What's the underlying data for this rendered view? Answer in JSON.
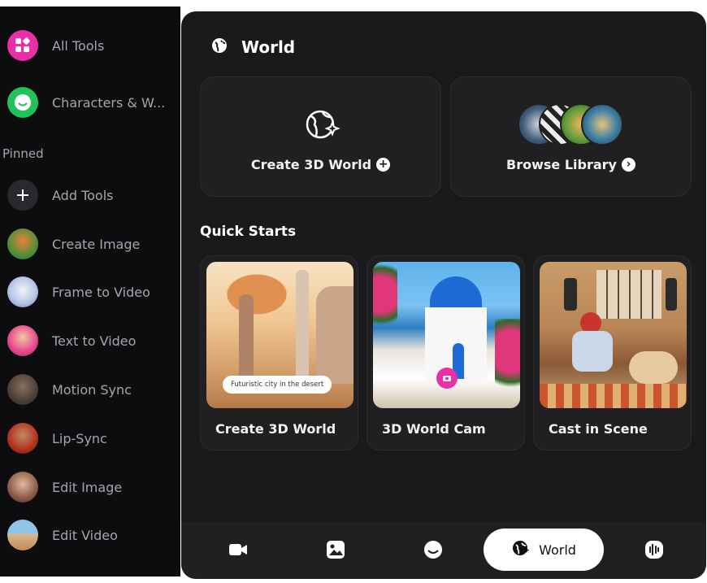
{
  "sidebar": {
    "items": [
      {
        "label": "All Tools",
        "icon": "grid-icon"
      },
      {
        "label": "Characters & W...",
        "icon": "smiley-icon"
      }
    ],
    "pinned_label": "Pinned",
    "pinned_items": [
      {
        "label": "Add Tools",
        "icon": "plus-icon"
      },
      {
        "label": "Create Image",
        "icon": "create-image-thumb"
      },
      {
        "label": "Frame to Video",
        "icon": "frame-to-video-thumb"
      },
      {
        "label": "Text to Video",
        "icon": "text-to-video-thumb"
      },
      {
        "label": "Motion Sync",
        "icon": "motion-sync-thumb"
      },
      {
        "label": "Lip-Sync",
        "icon": "lip-sync-thumb"
      },
      {
        "label": "Edit Image",
        "icon": "edit-image-thumb"
      },
      {
        "label": "Edit Video",
        "icon": "edit-video-thumb"
      }
    ]
  },
  "header": {
    "title": "World",
    "icon": "globe-sparkle-icon"
  },
  "actions": {
    "create": {
      "label": "Create 3D World",
      "icon": "globe-sparkle-icon",
      "badge": "plus-circle-icon"
    },
    "browse": {
      "label": "Browse Library",
      "badge": "chevron-right-circle-icon"
    }
  },
  "quick_starts": {
    "title": "Quick Starts",
    "cards": [
      {
        "label": "Create 3D World",
        "caption": "Futuristic city in the desert"
      },
      {
        "label": "3D World Cam"
      },
      {
        "label": "Cast in Scene"
      }
    ]
  },
  "bottom_nav": {
    "tabs": [
      {
        "name": "video-camera-icon"
      },
      {
        "name": "image-icon"
      },
      {
        "name": "character-icon"
      },
      {
        "name": "World",
        "active": true
      },
      {
        "name": "audio-icon"
      }
    ]
  },
  "colors": {
    "panel": "#1a1a1d",
    "card": "#202023",
    "sidebar": "#0d0d0f",
    "accent_pink": "#ea2fa8",
    "accent_green": "#21c25a"
  }
}
